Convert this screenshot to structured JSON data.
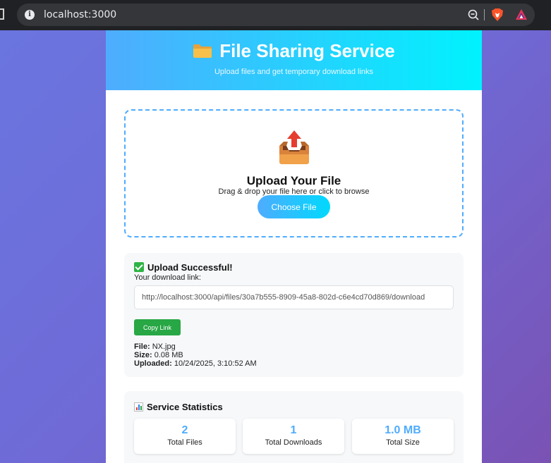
{
  "browser": {
    "url": "localhost:3000"
  },
  "header": {
    "title": "File Sharing Service",
    "subtitle": "Upload files and get temporary download links"
  },
  "upload": {
    "title": "Upload Your File",
    "subtitle": "Drag & drop your file here or click to browse",
    "button_label": "Choose File"
  },
  "result": {
    "title": "Upload Successful!",
    "link_label": "Your download link:",
    "link_value": "http://localhost:3000/api/files/30a7b555-8909-45a8-802d-c6e4cd70d869/download",
    "copy_label": "Copy Link",
    "file_label": "File:",
    "file_value": "NX.jpg",
    "size_label": "Size:",
    "size_value": "0.08 MB",
    "uploaded_label": "Uploaded:",
    "uploaded_value": "10/24/2025, 3:10:52 AM"
  },
  "stats": {
    "title": "Service Statistics",
    "items": [
      {
        "value": "2",
        "label": "Total Files"
      },
      {
        "value": "1",
        "label": "Total Downloads"
      },
      {
        "value": "1.0 MB",
        "label": "Total Size"
      }
    ]
  },
  "colors": {
    "accent": "#4facfe",
    "success": "#28a745"
  }
}
